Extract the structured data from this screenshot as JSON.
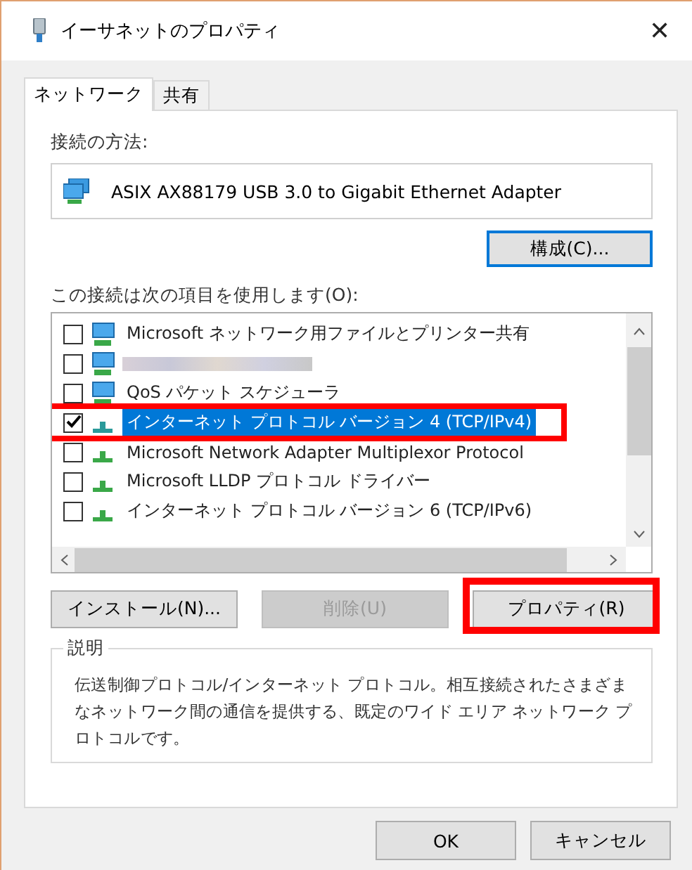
{
  "window": {
    "title": "イーサネットのプロパティ",
    "close": "✕"
  },
  "tabs": [
    {
      "label": "ネットワーク",
      "selected": true
    },
    {
      "label": "共有",
      "selected": false
    }
  ],
  "connect_using": {
    "label": "接続の方法:",
    "adapter": "ASIX AX88179 USB 3.0 to Gigabit Ethernet Adapter",
    "configure_button": "構成(C)..."
  },
  "items_label": "この接続は次の項目を使用します(O):",
  "items": [
    {
      "kind": "client",
      "label": "Microsoft ネットワーク用ファイルとプリンター共有",
      "checked": false,
      "selected": false,
      "highlighted": false
    },
    {
      "kind": "blurred",
      "checked": false,
      "selected": false,
      "highlighted": false
    },
    {
      "kind": "client",
      "label": "QoS パケット スケジューラ",
      "checked": false,
      "selected": false,
      "highlighted": false
    },
    {
      "kind": "protocol",
      "label": "インターネット プロトコル バージョン 4 (TCP/IPv4)",
      "checked": true,
      "selected": true,
      "highlighted": true
    },
    {
      "kind": "protocol",
      "label": "Microsoft Network Adapter Multiplexor Protocol",
      "checked": false,
      "selected": false,
      "highlighted": false
    },
    {
      "kind": "protocol",
      "label": "Microsoft LLDP プロトコル ドライバー",
      "checked": false,
      "selected": false,
      "highlighted": false
    },
    {
      "kind": "protocol",
      "label": "インターネット プロトコル バージョン 6 (TCP/IPv6)",
      "checked": false,
      "selected": false,
      "highlighted": false
    }
  ],
  "item_buttons": [
    {
      "label": "インストール(N)...",
      "disabled": false,
      "highlighted": false
    },
    {
      "label": "削除(U)",
      "disabled": true,
      "highlighted": false
    },
    {
      "label": "プロパティ(R)",
      "disabled": false,
      "highlighted": true
    }
  ],
  "description": {
    "title": "説明",
    "text": "伝送制御プロトコル/インターネット プロトコル。相互接続されたさまざまなネットワーク間の通信を提供する、既定のワイド エリア ネットワーク プロトコルです。"
  },
  "footer_buttons": [
    "OK",
    "キャンセル"
  ]
}
